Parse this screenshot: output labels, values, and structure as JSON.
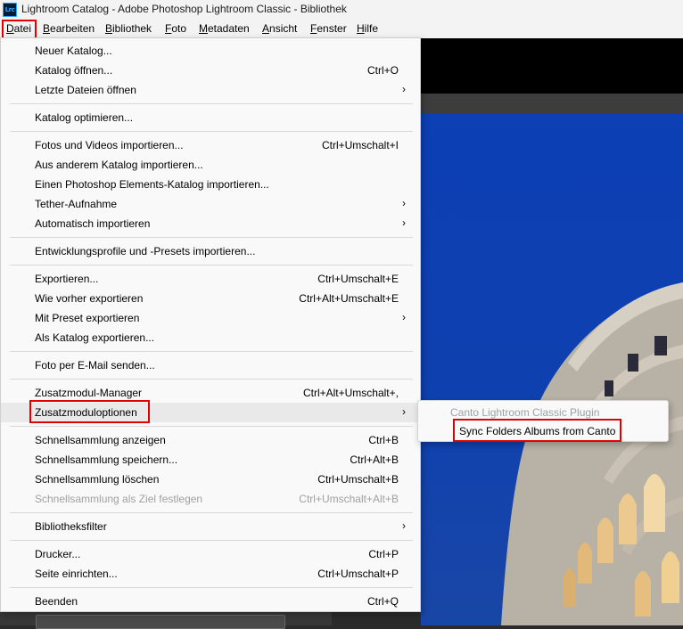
{
  "window": {
    "app_icon": "Lrc",
    "title": "Lightroom Catalog - Adobe Photoshop Lightroom Classic - Bibliothek"
  },
  "menubar": [
    {
      "first": "D",
      "rest": "atei"
    },
    {
      "first": "B",
      "rest": "earbeiten"
    },
    {
      "first": "B",
      "rest": "ibliothek"
    },
    {
      "first": "F",
      "rest": "oto"
    },
    {
      "first": "M",
      "rest": "etadaten"
    },
    {
      "first": "A",
      "rest": "nsicht"
    },
    {
      "first": "F",
      "rest": "enster"
    },
    {
      "first": "H",
      "rest": "ilfe"
    }
  ],
  "file_menu": {
    "items": [
      {
        "label": "Neuer Katalog...",
        "shortcut": ""
      },
      {
        "label": "Katalog öffnen...",
        "shortcut": "Ctrl+O"
      },
      {
        "label": "Letzte Dateien öffnen",
        "shortcut": "",
        "submenu": true
      },
      {
        "label": "Katalog optimieren...",
        "shortcut": ""
      },
      {
        "label": "Fotos und Videos importieren...",
        "shortcut": "Ctrl+Umschalt+I"
      },
      {
        "label": "Aus anderem Katalog importieren...",
        "shortcut": ""
      },
      {
        "label": "Einen Photoshop Elements-Katalog importieren...",
        "shortcut": ""
      },
      {
        "label": "Tether-Aufnahme",
        "shortcut": "",
        "submenu": true
      },
      {
        "label": "Automatisch importieren",
        "shortcut": "",
        "submenu": true
      },
      {
        "label": "Entwicklungsprofile und -Presets importieren...",
        "shortcut": ""
      },
      {
        "label": "Exportieren...",
        "shortcut": "Ctrl+Umschalt+E"
      },
      {
        "label": "Wie vorher exportieren",
        "shortcut": "Ctrl+Alt+Umschalt+E"
      },
      {
        "label": "Mit Preset exportieren",
        "shortcut": "",
        "submenu": true
      },
      {
        "label": "Als Katalog exportieren...",
        "shortcut": ""
      },
      {
        "label": "Foto per E-Mail senden...",
        "shortcut": ""
      },
      {
        "label": "Zusatzmodul-Manager",
        "shortcut": "Ctrl+Alt+Umschalt+,"
      },
      {
        "label": "Zusatzmoduloptionen",
        "shortcut": "",
        "submenu": true
      },
      {
        "label": "Schnellsammlung anzeigen",
        "shortcut": "Ctrl+B"
      },
      {
        "label": "Schnellsammlung speichern...",
        "shortcut": "Ctrl+Alt+B"
      },
      {
        "label": "Schnellsammlung löschen",
        "shortcut": "Ctrl+Umschalt+B"
      },
      {
        "label": "Schnellsammlung als Ziel festlegen",
        "shortcut": "Ctrl+Umschalt+Alt+B",
        "disabled": true
      },
      {
        "label": "Bibliotheksfilter",
        "shortcut": "",
        "submenu": true
      },
      {
        "label": "Drucker...",
        "shortcut": "Ctrl+P"
      },
      {
        "label": "Seite einrichten...",
        "shortcut": "Ctrl+Umschalt+P"
      },
      {
        "label": "Beenden",
        "shortcut": "Ctrl+Q"
      }
    ],
    "arrow_glyph": "›"
  },
  "plugin_submenu": {
    "header": "Canto Lightroom Classic Plugin",
    "item": "Sync Folders  Albums from Canto"
  },
  "colors": {
    "highlight_box": "#e00000",
    "sky": "#0d3fb5"
  }
}
